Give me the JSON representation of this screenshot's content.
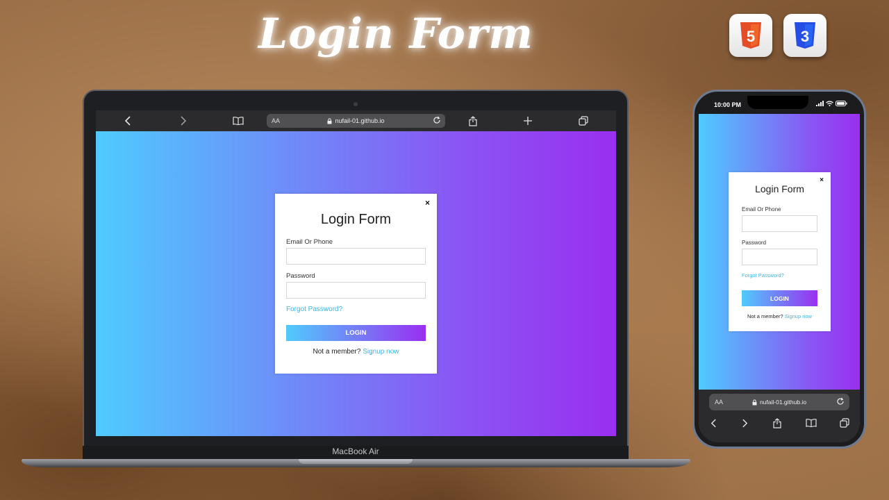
{
  "banner": {
    "title": "Login Form"
  },
  "badges": {
    "html5": "5",
    "css3": "3"
  },
  "laptop": {
    "url": "nufail-01.github.io",
    "text_size_label": "AA",
    "brand": "MacBook Air"
  },
  "phone": {
    "time": "10:00 PM",
    "url": "nufail-01.github.io",
    "text_size_label": "AA"
  },
  "login_form": {
    "close": "×",
    "title": "Login Form",
    "email_label": "Email Or Phone",
    "email_value": "",
    "password_label": "Password",
    "password_value": "",
    "forgot": "Forgot Password?",
    "login_button": "LOGIN",
    "signup_prompt": "Not a member?",
    "signup_link": "Signup now"
  },
  "colors": {
    "gradient_start": "#4fcbfe",
    "gradient_end": "#9a2ff0",
    "link": "#3bb6e6",
    "html5_orange": "#e44d26",
    "css3_blue": "#264de4"
  },
  "icons": [
    "back-icon",
    "forward-icon",
    "bookmarks-icon",
    "lock-icon",
    "reload-icon",
    "share-icon",
    "new-tab-icon",
    "tabs-icon",
    "signal-icon",
    "wifi-icon",
    "battery-icon"
  ]
}
